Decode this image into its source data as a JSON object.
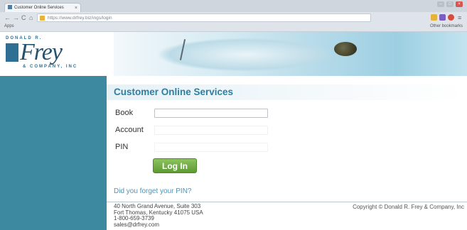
{
  "browser": {
    "tab_title": "Customer Online Services",
    "url": "https://www.drfrey.biz/ings/login",
    "bookmarks_apps": "Apps",
    "bookmarks_other": "Other bookmarks"
  },
  "logo": {
    "top_text": "DONALD R.",
    "word": "Frey",
    "bottom_text": "& COMPANY, INC"
  },
  "page": {
    "title": "Customer Online Services",
    "book_label": "Book",
    "account_label": "Account",
    "pin_label": "PIN",
    "login_label": "Log In",
    "forgot_link": "Did you forget your PIN?"
  },
  "footer": {
    "address_line1": "40 North Grand Avenue, Suite 303",
    "address_line2": "Fort Thomas, Kentucky 41075 USA",
    "phone": "1-800-659-3739",
    "email": "sales@drfrey.com",
    "copyright": "Copyright © Donald R. Frey & Company, Inc"
  },
  "colors": {
    "teal_sidebar": "#3d8aa0",
    "title_blue": "#2b7fa3",
    "login_green": "#6fae3f",
    "link_blue": "#4f94b7"
  }
}
